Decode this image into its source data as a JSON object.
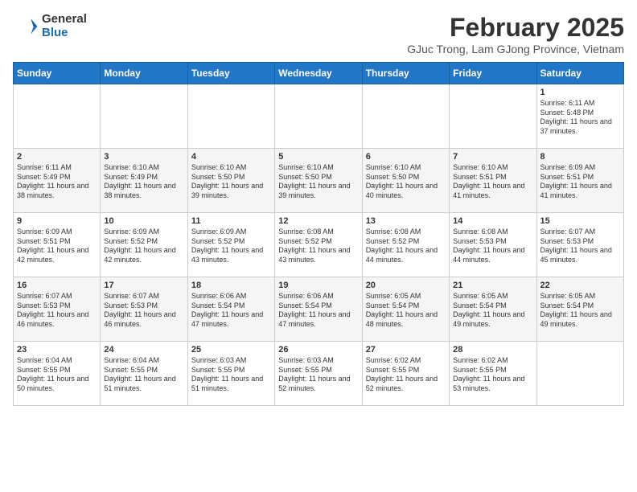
{
  "header": {
    "logo_general": "General",
    "logo_blue": "Blue",
    "month": "February 2025",
    "location": "GJuc Trong, Lam GJong Province, Vietnam"
  },
  "days_of_week": [
    "Sunday",
    "Monday",
    "Tuesday",
    "Wednesday",
    "Thursday",
    "Friday",
    "Saturday"
  ],
  "weeks": [
    [
      {
        "day": "",
        "info": ""
      },
      {
        "day": "",
        "info": ""
      },
      {
        "day": "",
        "info": ""
      },
      {
        "day": "",
        "info": ""
      },
      {
        "day": "",
        "info": ""
      },
      {
        "day": "",
        "info": ""
      },
      {
        "day": "1",
        "info": "Sunrise: 6:11 AM\nSunset: 5:48 PM\nDaylight: 11 hours and 37 minutes."
      }
    ],
    [
      {
        "day": "2",
        "info": "Sunrise: 6:11 AM\nSunset: 5:49 PM\nDaylight: 11 hours and 38 minutes."
      },
      {
        "day": "3",
        "info": "Sunrise: 6:10 AM\nSunset: 5:49 PM\nDaylight: 11 hours and 38 minutes."
      },
      {
        "day": "4",
        "info": "Sunrise: 6:10 AM\nSunset: 5:50 PM\nDaylight: 11 hours and 39 minutes."
      },
      {
        "day": "5",
        "info": "Sunrise: 6:10 AM\nSunset: 5:50 PM\nDaylight: 11 hours and 39 minutes."
      },
      {
        "day": "6",
        "info": "Sunrise: 6:10 AM\nSunset: 5:50 PM\nDaylight: 11 hours and 40 minutes."
      },
      {
        "day": "7",
        "info": "Sunrise: 6:10 AM\nSunset: 5:51 PM\nDaylight: 11 hours and 41 minutes."
      },
      {
        "day": "8",
        "info": "Sunrise: 6:09 AM\nSunset: 5:51 PM\nDaylight: 11 hours and 41 minutes."
      }
    ],
    [
      {
        "day": "9",
        "info": "Sunrise: 6:09 AM\nSunset: 5:51 PM\nDaylight: 11 hours and 42 minutes."
      },
      {
        "day": "10",
        "info": "Sunrise: 6:09 AM\nSunset: 5:52 PM\nDaylight: 11 hours and 42 minutes."
      },
      {
        "day": "11",
        "info": "Sunrise: 6:09 AM\nSunset: 5:52 PM\nDaylight: 11 hours and 43 minutes."
      },
      {
        "day": "12",
        "info": "Sunrise: 6:08 AM\nSunset: 5:52 PM\nDaylight: 11 hours and 43 minutes."
      },
      {
        "day": "13",
        "info": "Sunrise: 6:08 AM\nSunset: 5:52 PM\nDaylight: 11 hours and 44 minutes."
      },
      {
        "day": "14",
        "info": "Sunrise: 6:08 AM\nSunset: 5:53 PM\nDaylight: 11 hours and 44 minutes."
      },
      {
        "day": "15",
        "info": "Sunrise: 6:07 AM\nSunset: 5:53 PM\nDaylight: 11 hours and 45 minutes."
      }
    ],
    [
      {
        "day": "16",
        "info": "Sunrise: 6:07 AM\nSunset: 5:53 PM\nDaylight: 11 hours and 46 minutes."
      },
      {
        "day": "17",
        "info": "Sunrise: 6:07 AM\nSunset: 5:53 PM\nDaylight: 11 hours and 46 minutes."
      },
      {
        "day": "18",
        "info": "Sunrise: 6:06 AM\nSunset: 5:54 PM\nDaylight: 11 hours and 47 minutes."
      },
      {
        "day": "19",
        "info": "Sunrise: 6:06 AM\nSunset: 5:54 PM\nDaylight: 11 hours and 47 minutes."
      },
      {
        "day": "20",
        "info": "Sunrise: 6:05 AM\nSunset: 5:54 PM\nDaylight: 11 hours and 48 minutes."
      },
      {
        "day": "21",
        "info": "Sunrise: 6:05 AM\nSunset: 5:54 PM\nDaylight: 11 hours and 49 minutes."
      },
      {
        "day": "22",
        "info": "Sunrise: 6:05 AM\nSunset: 5:54 PM\nDaylight: 11 hours and 49 minutes."
      }
    ],
    [
      {
        "day": "23",
        "info": "Sunrise: 6:04 AM\nSunset: 5:55 PM\nDaylight: 11 hours and 50 minutes."
      },
      {
        "day": "24",
        "info": "Sunrise: 6:04 AM\nSunset: 5:55 PM\nDaylight: 11 hours and 51 minutes."
      },
      {
        "day": "25",
        "info": "Sunrise: 6:03 AM\nSunset: 5:55 PM\nDaylight: 11 hours and 51 minutes."
      },
      {
        "day": "26",
        "info": "Sunrise: 6:03 AM\nSunset: 5:55 PM\nDaylight: 11 hours and 52 minutes."
      },
      {
        "day": "27",
        "info": "Sunrise: 6:02 AM\nSunset: 5:55 PM\nDaylight: 11 hours and 52 minutes."
      },
      {
        "day": "28",
        "info": "Sunrise: 6:02 AM\nSunset: 5:55 PM\nDaylight: 11 hours and 53 minutes."
      },
      {
        "day": "",
        "info": ""
      }
    ]
  ]
}
